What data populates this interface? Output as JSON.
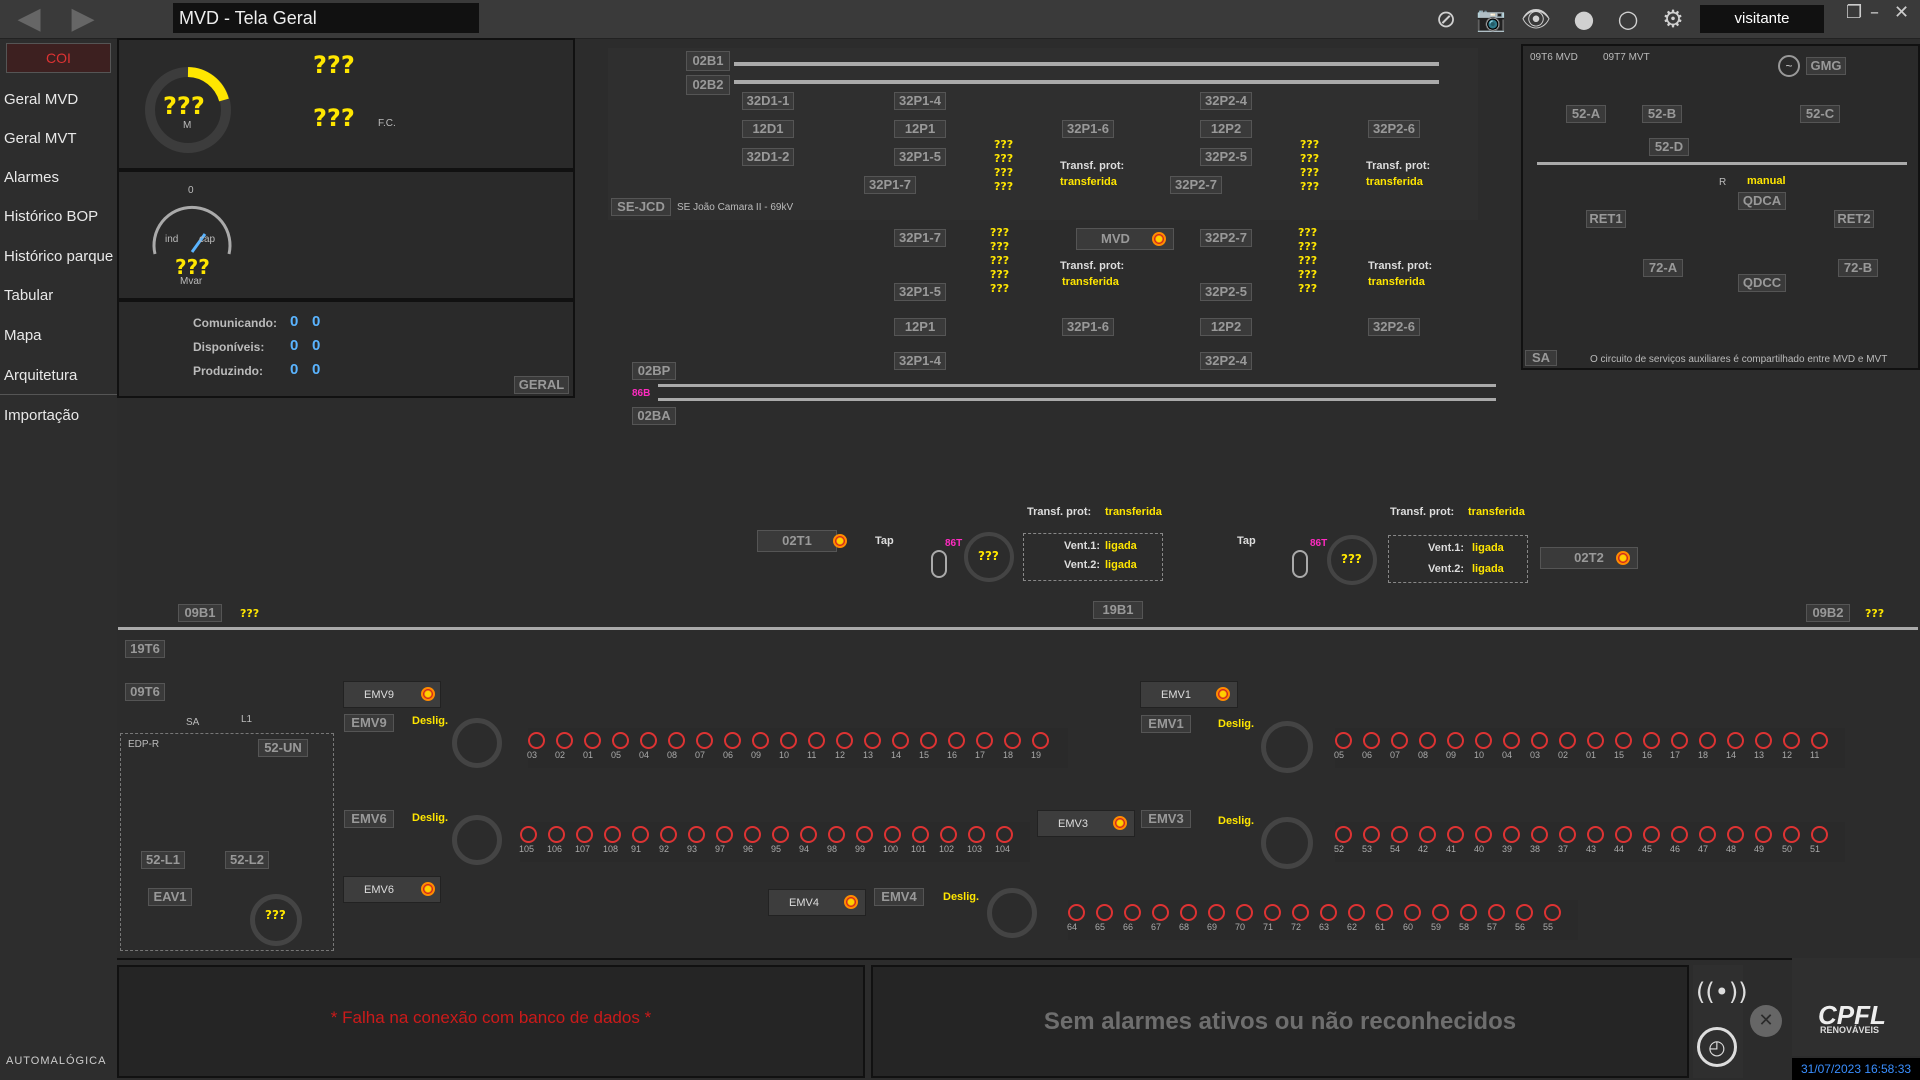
{
  "header": {
    "title": "MVD - Tela Geral",
    "user": "visitante"
  },
  "sidebar": {
    "coi": "COI",
    "items": [
      "Geral MVD",
      "Geral MVT",
      "Alarmes",
      "Histórico BOP",
      "Histórico parque",
      "Tabular",
      "Mapa",
      "Arquitetura",
      "Importação"
    ],
    "brand": "AUTOMALÓGICA"
  },
  "gauges": {
    "mw_value": "???",
    "mw_unit": "M",
    "val1": "???",
    "val2": "???",
    "fc_label": "F.C.",
    "mvar_value": "???",
    "mvar_unit": "Mvar",
    "ind": "ind",
    "cap": "cap",
    "zero": "0"
  },
  "status": {
    "comunicando": "Comunicando:",
    "disponiveis": "Disponíveis:",
    "produzindo": "Produzindo:",
    "v": "0",
    "geral": "GERAL"
  },
  "se": {
    "name": "SE-JCD",
    "desc": "SE João Camara II - 69kV",
    "bus1": "02B1",
    "bus2": "02B2",
    "mvd": "MVD",
    "transf_prot": "Transf. prot:",
    "transferida": "transferida"
  },
  "sa": {
    "tag1": "09T6 MVD",
    "tag2": "09T7 MVT",
    "gmg": "GMG",
    "b52a": "52-A",
    "b52b": "52-B",
    "b52c": "52-C",
    "b52d": "52-D",
    "manual": "manual",
    "r": "R",
    "qdca": "QDCA",
    "qdcc": "QDCC",
    "ret1": "RET1",
    "ret2": "RET2",
    "b72a": "72-A",
    "b72b": "72-B",
    "label": "SA",
    "note": "O circuito de serviços auxiliares é compartilhado entre MVD e MVT"
  },
  "mid": {
    "bp": "02BP",
    "ba": "02BA",
    "t1": "02T1",
    "t2": "02T2",
    "vent1": "Vent.1:",
    "vent2": "Vent.2:",
    "ligada": "ligada",
    "tap": "Tap",
    "b86": "86",
    "b86t": "86T",
    "b86b": "86B",
    "b09b1": "09B1",
    "b09b2": "09B2",
    "b19b1": "19B1"
  },
  "feeders": {
    "emv9": "EMV9",
    "emv1": "EMV1",
    "emv6": "EMV6",
    "emv3": "EMV3",
    "emv4": "EMV4",
    "deslig": "Deslig.",
    "edp": "EDP-R",
    "b52un": "52-UN",
    "b52l1": "52-L1",
    "b52l2": "52-L2",
    "eav1": "EAV1",
    "t19t6": "19T6",
    "t09t6": "09T6",
    "sa": "SA",
    "l1": "L1"
  },
  "turbines": {
    "row1a": [
      "03",
      "02",
      "01",
      "05",
      "04",
      "08",
      "07",
      "06",
      "09",
      "10",
      "11",
      "12",
      "13",
      "14",
      "15",
      "16",
      "17",
      "18",
      "19"
    ],
    "row1b": [
      "05",
      "06",
      "07",
      "08",
      "09",
      "10",
      "04",
      "03",
      "02",
      "01",
      "15",
      "16",
      "17",
      "18",
      "14",
      "13",
      "12",
      "11"
    ],
    "row2a": [
      "105",
      "106",
      "107",
      "108",
      "91",
      "92",
      "93",
      "97",
      "96",
      "95",
      "94",
      "98",
      "99",
      "100",
      "101",
      "102",
      "103",
      "104"
    ],
    "row2b": [
      "52",
      "53",
      "54",
      "42",
      "41",
      "40",
      "39",
      "38",
      "37",
      "43",
      "44",
      "45",
      "46",
      "47",
      "48",
      "49",
      "50",
      "51"
    ],
    "row3": [
      "64",
      "65",
      "66",
      "67",
      "68",
      "69",
      "70",
      "71",
      "72",
      "63",
      "62",
      "61",
      "60",
      "59",
      "58",
      "57",
      "56",
      "55"
    ]
  },
  "alarms": {
    "db_error": "* Falha na conexão com banco de dados *",
    "none": "Sem alarmes ativos ou não reconhecidos"
  },
  "footer": {
    "logo": "CPFL",
    "logo_sub": "RENOVÁVEIS",
    "datetime": "31/07/2023 16:58:33"
  },
  "colors": {
    "accent_yellow": "#ffe600",
    "alarm_red": "#cc1a1a",
    "pink": "#ff2bc1",
    "blue": "#5ab4ff"
  }
}
